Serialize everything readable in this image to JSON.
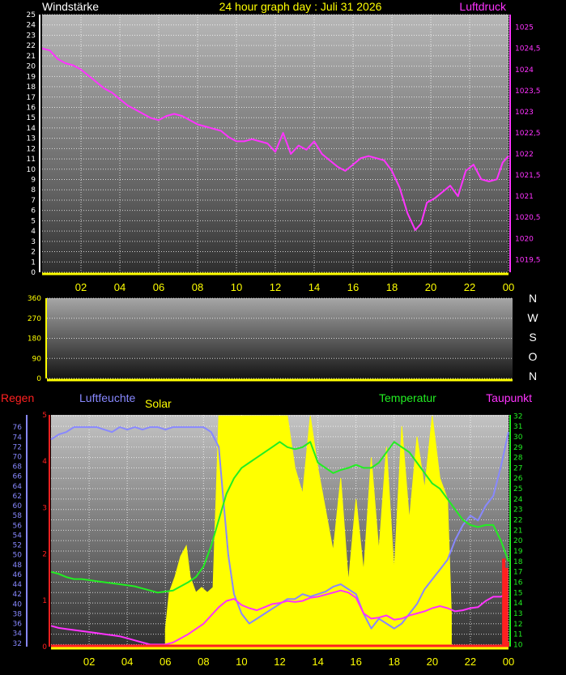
{
  "colors": {
    "wind": "#ffffff",
    "pressure": "#ff33ff",
    "rain": "#ff2020",
    "humidity": "#8888ff",
    "solar": "#ffff00",
    "temperature": "#22ee22",
    "dewpoint": "#ff33ff",
    "axis_yellow": "#ffff00"
  },
  "chart_data": [
    {
      "type": "line",
      "title": "24 hour graph day : Juli 31 2026",
      "left_label": "Windstärke",
      "right_label": "Luftdruck",
      "x_ticks": [
        "02",
        "04",
        "06",
        "08",
        "10",
        "12",
        "14",
        "16",
        "18",
        "20",
        "22",
        "00"
      ],
      "y_left_ticks": [
        "0",
        "1",
        "2",
        "3",
        "4",
        "5",
        "6",
        "7",
        "8",
        "9",
        "10",
        "11",
        "12",
        "13",
        "14",
        "15",
        "16",
        "17",
        "18",
        "19",
        "20",
        "21",
        "22",
        "23",
        "24",
        "25"
      ],
      "y_left_range": [
        0,
        25
      ],
      "y_right_ticks": [
        "1019,5",
        "1020",
        "1020,5",
        "1021",
        "1021,5",
        "1022",
        "1022,5",
        "1023",
        "1023,5",
        "1024",
        "1024,5",
        "1025"
      ],
      "y_right_range": [
        1019.2,
        1025.3
      ],
      "grid": true,
      "series": [
        {
          "name": "Luftdruck",
          "axis": "right",
          "x_hours": [
            0.0,
            0.4,
            0.8,
            1.2,
            1.6,
            2.0,
            2.4,
            2.8,
            3.2,
            3.6,
            4.0,
            4.4,
            4.8,
            5.2,
            5.6,
            6.0,
            6.4,
            6.8,
            7.2,
            7.6,
            8.0,
            8.4,
            8.8,
            9.2,
            9.6,
            10.0,
            10.4,
            10.8,
            11.2,
            11.6,
            12.0,
            12.4,
            12.8,
            13.2,
            13.6,
            14.0,
            14.4,
            14.8,
            15.2,
            15.6,
            16.0,
            16.4,
            16.8,
            17.2,
            17.6,
            18.0,
            18.4,
            18.8,
            19.2,
            19.5,
            19.8,
            20.2,
            20.6,
            21.0,
            21.4,
            21.8,
            22.2,
            22.6,
            23.0,
            23.4,
            23.7,
            24.0
          ],
          "values": [
            1024.5,
            1024.45,
            1024.25,
            1024.15,
            1024.1,
            1024.0,
            1023.85,
            1023.7,
            1023.55,
            1023.45,
            1023.3,
            1023.15,
            1023.05,
            1022.95,
            1022.85,
            1022.8,
            1022.9,
            1022.95,
            1022.9,
            1022.8,
            1022.7,
            1022.65,
            1022.6,
            1022.55,
            1022.4,
            1022.3,
            1022.3,
            1022.35,
            1022.3,
            1022.25,
            1022.05,
            1022.5,
            1022.0,
            1022.2,
            1022.1,
            1022.3,
            1022.0,
            1021.85,
            1021.7,
            1021.6,
            1021.75,
            1021.9,
            1021.95,
            1021.9,
            1021.85,
            1021.6,
            1021.2,
            1020.6,
            1020.2,
            1020.35,
            1020.85,
            1020.95,
            1021.1,
            1021.25,
            1021.0,
            1021.6,
            1021.75,
            1021.4,
            1021.35,
            1021.4,
            1021.8,
            1021.95
          ]
        }
      ]
    },
    {
      "type": "scatter",
      "y_ticks": [
        "0",
        "90",
        "180",
        "270",
        "360"
      ],
      "y_range": [
        0,
        360
      ],
      "compass_labels": [
        "N",
        "W",
        "S",
        "O",
        "N"
      ],
      "series": []
    },
    {
      "type": "line",
      "labels": {
        "rain": "Regen",
        "humidity": "Luftfeuchte",
        "solar": "Solar",
        "temperature": "Temperatur",
        "dewpoint": "Taupunkt"
      },
      "x_ticks": [
        "02",
        "04",
        "06",
        "08",
        "10",
        "12",
        "14",
        "16",
        "18",
        "20",
        "22",
        "00"
      ],
      "y_left_ticks": [
        "32",
        "34",
        "36",
        "38",
        "40",
        "42",
        "44",
        "46",
        "48",
        "50",
        "52",
        "54",
        "56",
        "58",
        "60",
        "62",
        "64",
        "66",
        "68",
        "70",
        "72",
        "74",
        "76"
      ],
      "y_left_range": [
        31.3,
        78.5
      ],
      "y_rain_ticks": [
        "0",
        "1",
        "2",
        "3",
        "4",
        "5"
      ],
      "y_rain_range": [
        0,
        5
      ],
      "y_right_ticks": [
        "10",
        "11",
        "12",
        "13",
        "14",
        "15",
        "16",
        "17",
        "18",
        "19",
        "20",
        "21",
        "22",
        "23",
        "24",
        "25",
        "26",
        "27",
        "28",
        "29",
        "30",
        "31",
        "32"
      ],
      "y_right_range": [
        9.8,
        32.1
      ],
      "grid": true,
      "series": [
        {
          "name": "Solar",
          "axis": "right",
          "x_hours": [
            6.0,
            6.2,
            6.5,
            6.8,
            7.1,
            7.3,
            7.6,
            7.9,
            8.2,
            8.5,
            8.8,
            9.0,
            9.4,
            9.8,
            10.2,
            10.6,
            11.0,
            11.4,
            11.8,
            12.0,
            12.4,
            12.8,
            13.2,
            13.6,
            14.0,
            14.4,
            14.8,
            15.2,
            15.6,
            16.0,
            16.4,
            16.8,
            17.2,
            17.6,
            18.0,
            18.4,
            18.8,
            19.2,
            19.6,
            20.0,
            20.4,
            20.8,
            21.0
          ],
          "values": [
            11.5,
            15.0,
            16.5,
            18.5,
            19.5,
            16.5,
            15.0,
            15.5,
            15.0,
            15.5,
            32.0,
            32.0,
            32.0,
            32.0,
            32.0,
            32.0,
            32.0,
            32.0,
            32.0,
            32.0,
            32.0,
            27.0,
            24.5,
            32.0,
            27.0,
            23.0,
            19.0,
            26.0,
            16.0,
            24.0,
            17.0,
            28.0,
            19.0,
            29.0,
            17.0,
            31.0,
            22.0,
            30.0,
            25.0,
            32.0,
            26.0,
            24.0,
            13.0
          ]
        },
        {
          "name": "Luftfeuchte",
          "axis": "left",
          "x_hours": [
            0.0,
            0.4,
            0.8,
            1.2,
            1.6,
            2.0,
            2.4,
            2.8,
            3.2,
            3.6,
            4.0,
            4.4,
            4.8,
            5.2,
            5.6,
            6.0,
            6.4,
            6.8,
            7.2,
            7.6,
            8.0,
            8.4,
            8.8,
            9.0,
            9.3,
            9.6,
            10.0,
            10.4,
            10.8,
            11.2,
            11.6,
            12.0,
            12.4,
            12.8,
            13.2,
            13.6,
            14.0,
            14.4,
            14.8,
            15.2,
            15.6,
            16.0,
            16.4,
            16.8,
            17.2,
            17.6,
            18.0,
            18.4,
            18.8,
            19.2,
            19.6,
            20.0,
            20.4,
            20.8,
            21.2,
            21.6,
            22.0,
            22.4,
            22.8,
            23.2,
            23.6,
            24.0
          ],
          "values": [
            73.5,
            74.5,
            75.0,
            76.0,
            76.0,
            76.0,
            76.0,
            75.5,
            75.0,
            76.0,
            75.5,
            76.0,
            75.5,
            76.0,
            76.0,
            75.5,
            76.0,
            76.0,
            76.0,
            76.0,
            76.0,
            75.0,
            72.0,
            63.0,
            50.0,
            42.0,
            38.0,
            36.0,
            37.0,
            38.0,
            39.0,
            40.0,
            41.0,
            41.0,
            42.0,
            41.5,
            42.0,
            42.5,
            43.5,
            44.0,
            43.0,
            42.0,
            38.0,
            35.0,
            37.0,
            36.0,
            35.0,
            36.0,
            38.0,
            40.0,
            43.0,
            45.0,
            47.0,
            49.0,
            53.0,
            56.0,
            58.0,
            57.0,
            60.0,
            62.0,
            68.0,
            75.0
          ]
        },
        {
          "name": "Temperatur",
          "axis": "right",
          "x_hours": [
            0.0,
            0.4,
            0.8,
            1.2,
            1.6,
            2.0,
            2.4,
            2.8,
            3.2,
            3.6,
            4.0,
            4.4,
            4.8,
            5.2,
            5.6,
            6.0,
            6.4,
            6.8,
            7.2,
            7.6,
            8.0,
            8.4,
            8.8,
            9.2,
            9.6,
            10.0,
            10.4,
            10.8,
            11.2,
            11.6,
            12.0,
            12.4,
            12.8,
            13.2,
            13.6,
            14.0,
            14.4,
            14.8,
            15.2,
            15.6,
            16.0,
            16.4,
            16.8,
            17.2,
            17.6,
            18.0,
            18.4,
            18.8,
            19.2,
            19.6,
            20.0,
            20.4,
            20.8,
            21.2,
            21.6,
            22.0,
            22.4,
            22.8,
            23.2,
            23.6,
            24.0
          ],
          "values": [
            17.0,
            16.8,
            16.5,
            16.3,
            16.3,
            16.2,
            16.1,
            16.0,
            15.9,
            15.8,
            15.7,
            15.6,
            15.4,
            15.2,
            15.0,
            15.1,
            15.2,
            15.6,
            16.0,
            16.5,
            17.5,
            19.5,
            22.0,
            24.5,
            26.0,
            27.0,
            27.5,
            28.0,
            28.5,
            29.0,
            29.5,
            29.0,
            28.8,
            29.0,
            29.5,
            27.5,
            27.0,
            26.5,
            26.8,
            27.0,
            27.3,
            27.0,
            27.0,
            27.5,
            28.5,
            29.5,
            29.0,
            28.5,
            27.5,
            26.5,
            25.5,
            25.0,
            24.0,
            23.0,
            22.0,
            21.5,
            21.3,
            21.5,
            21.5,
            20.0,
            18.0
          ]
        },
        {
          "name": "Taupunkt",
          "axis": "right",
          "x_hours": [
            0.0,
            0.4,
            0.8,
            1.2,
            1.6,
            2.0,
            2.4,
            2.8,
            3.2,
            3.6,
            4.0,
            4.4,
            4.8,
            5.2,
            5.6,
            6.0,
            6.4,
            6.8,
            7.2,
            7.6,
            8.0,
            8.4,
            8.8,
            9.2,
            9.6,
            10.0,
            10.4,
            10.8,
            11.2,
            11.6,
            12.0,
            12.4,
            12.8,
            13.2,
            13.6,
            14.0,
            14.4,
            14.8,
            15.2,
            15.6,
            16.0,
            16.4,
            16.8,
            17.2,
            17.6,
            18.0,
            18.4,
            18.8,
            19.2,
            19.6,
            20.0,
            20.4,
            20.8,
            21.2,
            21.6,
            22.0,
            22.4,
            22.8,
            23.2,
            23.6,
            24.0
          ],
          "values": [
            11.8,
            11.6,
            11.5,
            11.4,
            11.3,
            11.2,
            11.1,
            11.0,
            10.9,
            10.8,
            10.6,
            10.4,
            10.2,
            10.0,
            10.0,
            10.0,
            10.2,
            10.6,
            11.0,
            11.5,
            12.0,
            12.8,
            13.6,
            14.2,
            14.4,
            13.8,
            13.5,
            13.3,
            13.6,
            13.9,
            14.0,
            14.2,
            14.1,
            14.2,
            14.5,
            14.6,
            14.8,
            15.0,
            15.2,
            15.0,
            14.5,
            13.0,
            12.5,
            12.6,
            12.8,
            12.4,
            12.5,
            12.8,
            13.0,
            13.2,
            13.5,
            13.7,
            13.5,
            13.2,
            13.3,
            13.5,
            13.6,
            14.2,
            14.6,
            14.6,
            15.0
          ]
        },
        {
          "name": "Regen",
          "axis": "rain",
          "x_hours": [
            0.0,
            23.6,
            23.75,
            23.9,
            24.0
          ],
          "values": [
            0.0,
            0.0,
            1.9,
            1.7,
            0.1
          ]
        }
      ]
    }
  ]
}
